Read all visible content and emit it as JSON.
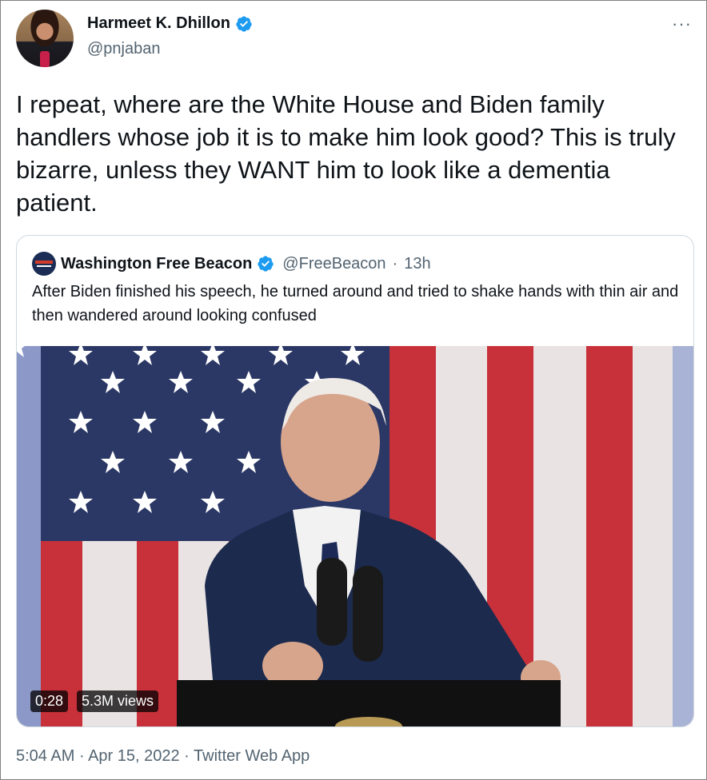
{
  "author": {
    "name": "Harmeet K. Dhillon",
    "handle": "@pnjaban"
  },
  "more_label": "···",
  "tweet_text": "I repeat, where are the White House and Biden family handlers whose job it is to make him look good? This is truly bizarre, unless they WANT him to look like a dementia patient.",
  "quoted": {
    "name": "Washington Free Beacon",
    "handle": "@FreeBeacon",
    "separator": "·",
    "time": "13h",
    "text": "After Biden finished his speech, he turned around and tried to shake hands with thin air and then wandered around looking confused",
    "video": {
      "duration": "0:28",
      "views": "5.3M views"
    }
  },
  "meta": {
    "time": "5:04 AM",
    "sep1": "·",
    "date": "Apr 15, 2022",
    "sep2": "·",
    "source": "Twitter Web App"
  },
  "colors": {
    "verified": "#1d9bf0",
    "secondary_text": "#536471",
    "flag_red": "#c8313a",
    "flag_blue": "#2b3866",
    "suit": "#1c2a4e"
  },
  "icons": [
    "verified-icon",
    "more-icon"
  ]
}
